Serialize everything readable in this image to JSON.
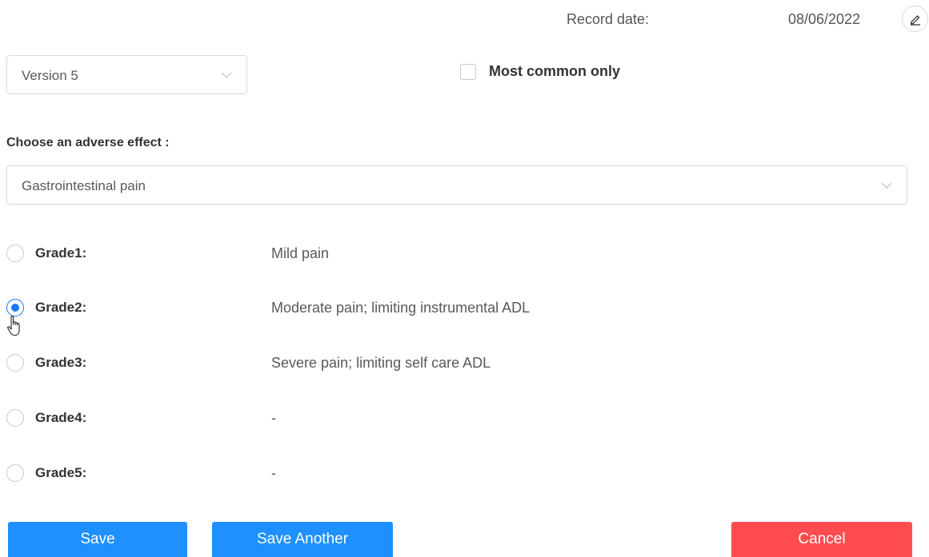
{
  "header": {
    "record_date_label": "Record date:",
    "record_date_value": "08/06/2022",
    "edit_icon": "pencil-icon"
  },
  "version_select": {
    "value": "Version 5",
    "icon": "chevron-down-icon"
  },
  "most_common": {
    "label": "Most common only",
    "checked": false
  },
  "adverse_effect": {
    "label": "Choose an adverse effect :",
    "value": "Gastrointestinal pain",
    "icon": "chevron-down-icon"
  },
  "grades": [
    {
      "name": "Grade1:",
      "description": "Mild pain",
      "selected": false
    },
    {
      "name": "Grade2:",
      "description": "Moderate pain; limiting instrumental ADL",
      "selected": true
    },
    {
      "name": "Grade3:",
      "description": "Severe pain; limiting self care ADL",
      "selected": false
    },
    {
      "name": "Grade4:",
      "description": "-",
      "selected": false
    },
    {
      "name": "Grade5:",
      "description": "-",
      "selected": false
    }
  ],
  "buttons": {
    "save": "Save",
    "save_another": "Save Another",
    "cancel": "Cancel"
  },
  "colors": {
    "primary": "#1e90ff",
    "danger": "#ff4d4f",
    "radio_selected": "#1677ff"
  }
}
